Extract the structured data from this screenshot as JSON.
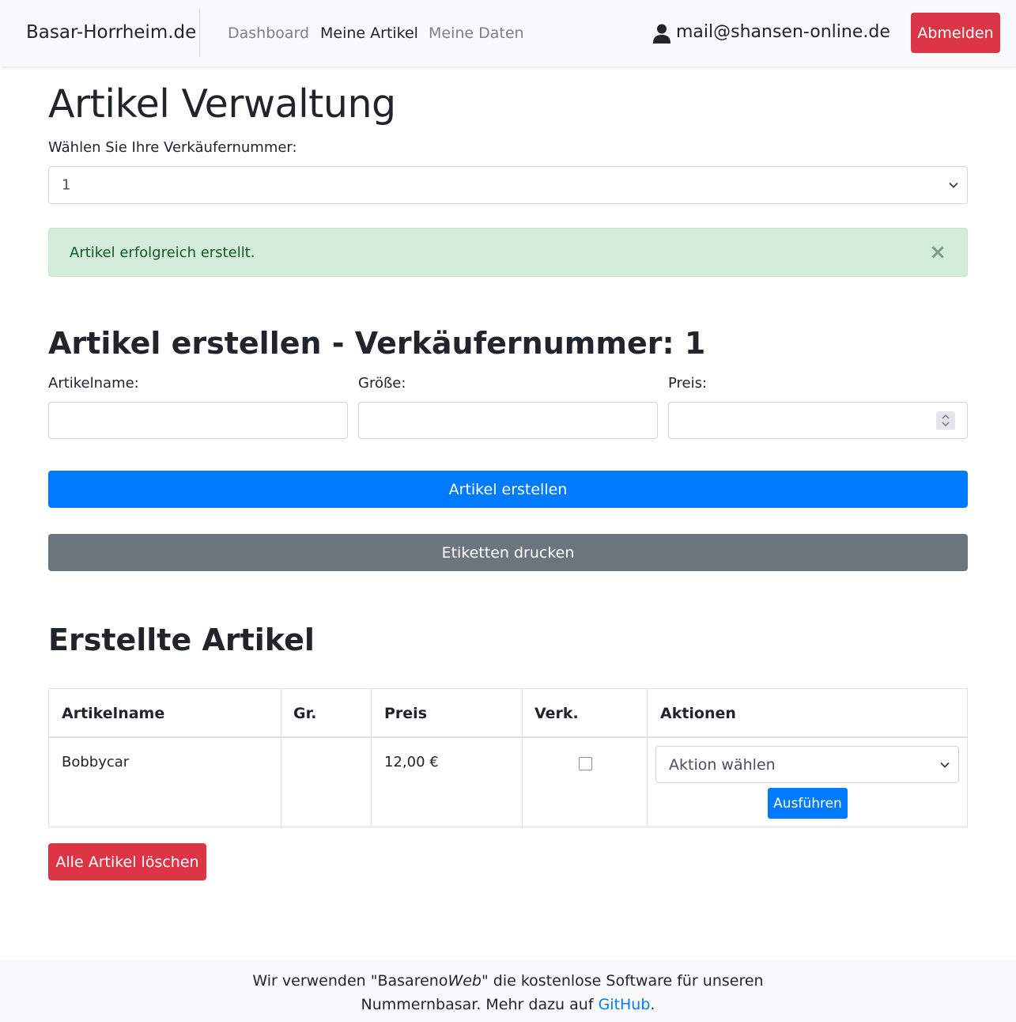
{
  "navbar": {
    "brand": "Basar-Horrheim.de",
    "links": [
      "Dashboard",
      "Meine Artikel",
      "Meine Daten"
    ],
    "user_email": "mail@shansen-online.de",
    "logout_label": "Abmelden",
    "user_icon": "user-icon"
  },
  "main": {
    "title": "Artikel Verwaltung",
    "seller_label": "Wählen Sie Ihre Verkäufernummer:",
    "seller_selected": "1",
    "alert": {
      "message": "Artikel erfolgreich erstellt.",
      "close": "×"
    },
    "create": {
      "title": "Artikel erstellen - Verkäufernummer: 1",
      "name_label": "Artikelname:",
      "size_label": "Größe:",
      "price_label": "Preis:",
      "name_value": "",
      "size_value": "",
      "price_value": "",
      "submit_label": "Artikel erstellen",
      "print_label": "Etiketten drucken"
    },
    "list": {
      "title": "Erstellte Artikel",
      "headers": [
        "Artikelname",
        "Gr.",
        "Preis",
        "Verk.",
        "Aktionen"
      ],
      "rows": [
        {
          "name": "Bobbycar",
          "size": "",
          "price": "12,00 €",
          "sold": false,
          "action_selected": "Aktion wählen",
          "execute_label": "Ausführen"
        }
      ],
      "delete_all_label": "Alle Artikel löschen"
    }
  },
  "footer": {
    "line1_prefix": "Wir verwenden \"Basareno",
    "line1_em": "Web",
    "line1_suffix": "\" die kostenlose Software für unseren",
    "line2_prefix": "Nummernbasar. Mehr dazu auf ",
    "line2_link": "GitHub",
    "line2_suffix": "."
  },
  "colors": {
    "primary": "#007bff",
    "danger": "#dc3545",
    "secondary": "#6c757d",
    "success_bg": "#d4edda",
    "success_text": "#155724"
  }
}
